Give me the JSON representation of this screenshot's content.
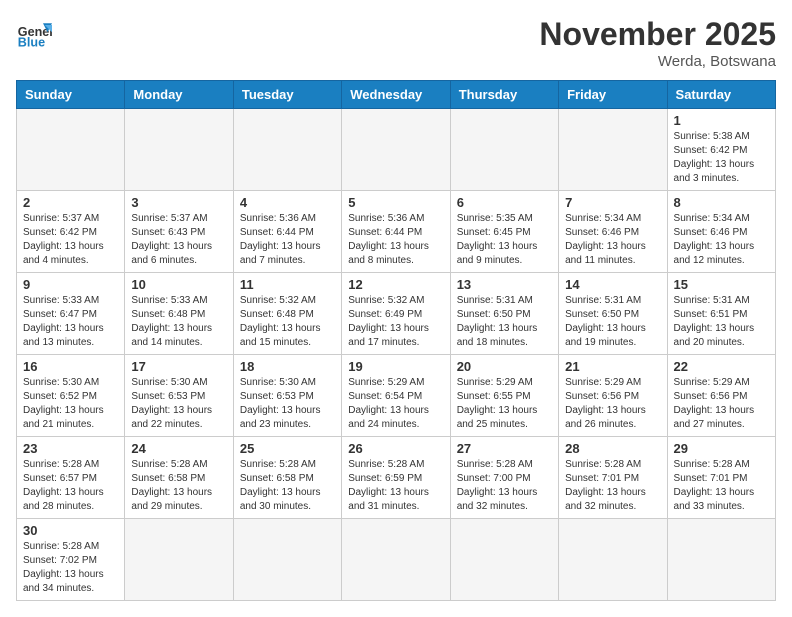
{
  "header": {
    "logo_general": "General",
    "logo_blue": "Blue",
    "month_title": "November 2025",
    "location": "Werda, Botswana"
  },
  "weekdays": [
    "Sunday",
    "Monday",
    "Tuesday",
    "Wednesday",
    "Thursday",
    "Friday",
    "Saturday"
  ],
  "weeks": [
    [
      {
        "day": "",
        "info": ""
      },
      {
        "day": "",
        "info": ""
      },
      {
        "day": "",
        "info": ""
      },
      {
        "day": "",
        "info": ""
      },
      {
        "day": "",
        "info": ""
      },
      {
        "day": "",
        "info": ""
      },
      {
        "day": "1",
        "info": "Sunrise: 5:38 AM\nSunset: 6:42 PM\nDaylight: 13 hours\nand 3 minutes."
      }
    ],
    [
      {
        "day": "2",
        "info": "Sunrise: 5:37 AM\nSunset: 6:42 PM\nDaylight: 13 hours\nand 4 minutes."
      },
      {
        "day": "3",
        "info": "Sunrise: 5:37 AM\nSunset: 6:43 PM\nDaylight: 13 hours\nand 6 minutes."
      },
      {
        "day": "4",
        "info": "Sunrise: 5:36 AM\nSunset: 6:44 PM\nDaylight: 13 hours\nand 7 minutes."
      },
      {
        "day": "5",
        "info": "Sunrise: 5:36 AM\nSunset: 6:44 PM\nDaylight: 13 hours\nand 8 minutes."
      },
      {
        "day": "6",
        "info": "Sunrise: 5:35 AM\nSunset: 6:45 PM\nDaylight: 13 hours\nand 9 minutes."
      },
      {
        "day": "7",
        "info": "Sunrise: 5:34 AM\nSunset: 6:46 PM\nDaylight: 13 hours\nand 11 minutes."
      },
      {
        "day": "8",
        "info": "Sunrise: 5:34 AM\nSunset: 6:46 PM\nDaylight: 13 hours\nand 12 minutes."
      }
    ],
    [
      {
        "day": "9",
        "info": "Sunrise: 5:33 AM\nSunset: 6:47 PM\nDaylight: 13 hours\nand 13 minutes."
      },
      {
        "day": "10",
        "info": "Sunrise: 5:33 AM\nSunset: 6:48 PM\nDaylight: 13 hours\nand 14 minutes."
      },
      {
        "day": "11",
        "info": "Sunrise: 5:32 AM\nSunset: 6:48 PM\nDaylight: 13 hours\nand 15 minutes."
      },
      {
        "day": "12",
        "info": "Sunrise: 5:32 AM\nSunset: 6:49 PM\nDaylight: 13 hours\nand 17 minutes."
      },
      {
        "day": "13",
        "info": "Sunrise: 5:31 AM\nSunset: 6:50 PM\nDaylight: 13 hours\nand 18 minutes."
      },
      {
        "day": "14",
        "info": "Sunrise: 5:31 AM\nSunset: 6:50 PM\nDaylight: 13 hours\nand 19 minutes."
      },
      {
        "day": "15",
        "info": "Sunrise: 5:31 AM\nSunset: 6:51 PM\nDaylight: 13 hours\nand 20 minutes."
      }
    ],
    [
      {
        "day": "16",
        "info": "Sunrise: 5:30 AM\nSunset: 6:52 PM\nDaylight: 13 hours\nand 21 minutes."
      },
      {
        "day": "17",
        "info": "Sunrise: 5:30 AM\nSunset: 6:53 PM\nDaylight: 13 hours\nand 22 minutes."
      },
      {
        "day": "18",
        "info": "Sunrise: 5:30 AM\nSunset: 6:53 PM\nDaylight: 13 hours\nand 23 minutes."
      },
      {
        "day": "19",
        "info": "Sunrise: 5:29 AM\nSunset: 6:54 PM\nDaylight: 13 hours\nand 24 minutes."
      },
      {
        "day": "20",
        "info": "Sunrise: 5:29 AM\nSunset: 6:55 PM\nDaylight: 13 hours\nand 25 minutes."
      },
      {
        "day": "21",
        "info": "Sunrise: 5:29 AM\nSunset: 6:56 PM\nDaylight: 13 hours\nand 26 minutes."
      },
      {
        "day": "22",
        "info": "Sunrise: 5:29 AM\nSunset: 6:56 PM\nDaylight: 13 hours\nand 27 minutes."
      }
    ],
    [
      {
        "day": "23",
        "info": "Sunrise: 5:28 AM\nSunset: 6:57 PM\nDaylight: 13 hours\nand 28 minutes."
      },
      {
        "day": "24",
        "info": "Sunrise: 5:28 AM\nSunset: 6:58 PM\nDaylight: 13 hours\nand 29 minutes."
      },
      {
        "day": "25",
        "info": "Sunrise: 5:28 AM\nSunset: 6:58 PM\nDaylight: 13 hours\nand 30 minutes."
      },
      {
        "day": "26",
        "info": "Sunrise: 5:28 AM\nSunset: 6:59 PM\nDaylight: 13 hours\nand 31 minutes."
      },
      {
        "day": "27",
        "info": "Sunrise: 5:28 AM\nSunset: 7:00 PM\nDaylight: 13 hours\nand 32 minutes."
      },
      {
        "day": "28",
        "info": "Sunrise: 5:28 AM\nSunset: 7:01 PM\nDaylight: 13 hours\nand 32 minutes."
      },
      {
        "day": "29",
        "info": "Sunrise: 5:28 AM\nSunset: 7:01 PM\nDaylight: 13 hours\nand 33 minutes."
      }
    ],
    [
      {
        "day": "30",
        "info": "Sunrise: 5:28 AM\nSunset: 7:02 PM\nDaylight: 13 hours\nand 34 minutes."
      },
      {
        "day": "",
        "info": ""
      },
      {
        "day": "",
        "info": ""
      },
      {
        "day": "",
        "info": ""
      },
      {
        "day": "",
        "info": ""
      },
      {
        "day": "",
        "info": ""
      },
      {
        "day": "",
        "info": ""
      }
    ]
  ]
}
